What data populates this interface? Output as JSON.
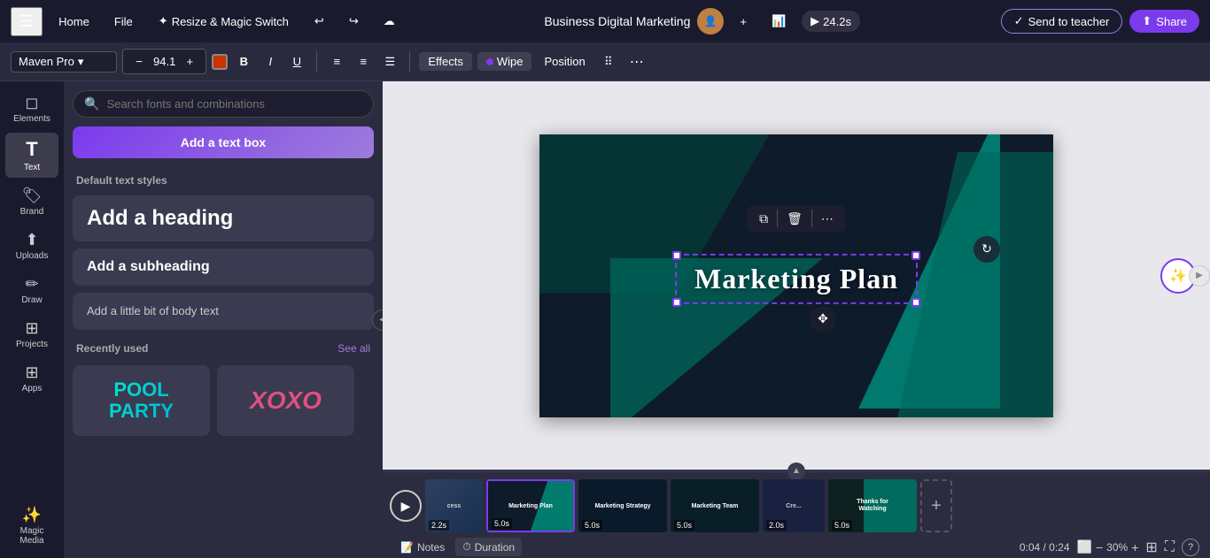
{
  "topbar": {
    "menu_icon": "☰",
    "home_label": "Home",
    "file_label": "File",
    "magic_label": "Resize & Magic Switch",
    "undo_icon": "↩",
    "redo_icon": "↪",
    "save_icon": "☁",
    "title": "Business Digital Marketing",
    "plus_icon": "+",
    "analytics_icon": "📊",
    "play_icon": "▶",
    "timer": "24.2s",
    "send_teacher_label": "Send to teacher",
    "share_label": "Share",
    "send_icon": "✓",
    "share_icon": "⬆"
  },
  "fontbar": {
    "font_name": "Maven Pro",
    "font_size": "94.1",
    "minus_icon": "−",
    "plus_icon": "+",
    "color": "#cc3300",
    "bold": "B",
    "italic": "I",
    "underline": "U",
    "align_icons": [
      "≡",
      "≡",
      "≡"
    ],
    "effects_label": "Effects",
    "wipe_label": "Wipe",
    "position_label": "Position",
    "more_icon": "⋯",
    "grid_icon": "⠿"
  },
  "left_sidebar": {
    "items": [
      {
        "icon": "◻",
        "label": "Elements"
      },
      {
        "icon": "T",
        "label": "Text",
        "active": true
      },
      {
        "icon": "🏷",
        "label": "Brand"
      },
      {
        "icon": "⬆",
        "label": "Uploads"
      },
      {
        "icon": "✏",
        "label": "Draw"
      },
      {
        "icon": "⊞",
        "label": "Projects"
      },
      {
        "icon": "⊞",
        "label": "Apps"
      },
      {
        "icon": "✨",
        "label": "Magic Media"
      }
    ]
  },
  "left_panel": {
    "search_placeholder": "Search fonts and combinations",
    "add_text_btn": "Add a text box",
    "default_styles_label": "Default text styles",
    "heading_text": "Add a heading",
    "subheading_text": "Add a subheading",
    "body_text": "Add a little bit of body text",
    "recently_used_label": "Recently used",
    "see_all_label": "See all",
    "font_preview1": "POOL\nPARTY",
    "font_preview2": "XOXO"
  },
  "canvas": {
    "slide_text": "Marketing Plan",
    "float_toolbar": {
      "copy_icon": "⧉",
      "trash_icon": "🗑",
      "more_icon": "⋯"
    }
  },
  "timeline": {
    "play_icon": "▶",
    "slides": [
      {
        "label": "",
        "time": "2.2s",
        "active": false,
        "bg": "#2d4060"
      },
      {
        "label": "Marketing Plan",
        "time": "5.0s",
        "active": true,
        "bg": "#0d1b2a"
      },
      {
        "label": "Marketing Strategy",
        "time": "5.0s",
        "active": false,
        "bg": "#0d2030"
      },
      {
        "label": "Marketing Team",
        "time": "5.0s",
        "active": false,
        "bg": "#0d1e2a"
      },
      {
        "label": "Cre...",
        "time": "2.0s",
        "active": false,
        "bg": "#1a2035"
      },
      {
        "label": "Thanks for Watching",
        "time": "5.0s",
        "active": false,
        "bg": "#0d2820"
      }
    ],
    "add_icon": "+",
    "time_display": "0:04 / 0:24",
    "zoom_level": "30%",
    "notes_label": "Notes",
    "duration_label": "Duration",
    "notes_icon": "📝",
    "duration_icon": "⏱"
  }
}
